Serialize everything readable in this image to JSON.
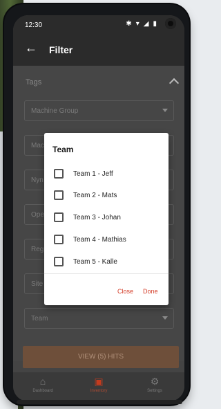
{
  "status_bar": {
    "time": "12:30",
    "icons": [
      "bluetooth-icon",
      "wifi-icon",
      "signal-icon",
      "battery-icon"
    ]
  },
  "app_bar": {
    "back_glyph": "←",
    "title": "Filter"
  },
  "filter": {
    "section_label": "Tags",
    "fields": [
      {
        "label": "Machine Group"
      },
      {
        "label": "Mac"
      },
      {
        "label": "Nyn"
      },
      {
        "label": "Ope"
      },
      {
        "label": "Reg"
      },
      {
        "label": "Site"
      },
      {
        "label": "Team"
      }
    ],
    "hits_button": "VIEW (5) HITS"
  },
  "dialog": {
    "title": "Team",
    "options": [
      {
        "label": "Team 1 - Jeff",
        "checked": false
      },
      {
        "label": "Team 2 - Mats",
        "checked": false
      },
      {
        "label": "Team 3 - Johan",
        "checked": false
      },
      {
        "label": "Team 4 - Mathias",
        "checked": false
      },
      {
        "label": "Team 5 - Kalle",
        "checked": false
      }
    ],
    "close_label": "Close",
    "done_label": "Done"
  },
  "bottom_nav": [
    {
      "label": "Dashboard",
      "icon": "dashboard-icon",
      "active": false
    },
    {
      "label": "Inventory",
      "icon": "inventory-icon",
      "active": true
    },
    {
      "label": "Settings",
      "icon": "settings-icon",
      "active": false
    }
  ],
  "colors": {
    "accent": "#d33b26",
    "dialog_bg": "#ffffff",
    "overlay": "#464646"
  }
}
